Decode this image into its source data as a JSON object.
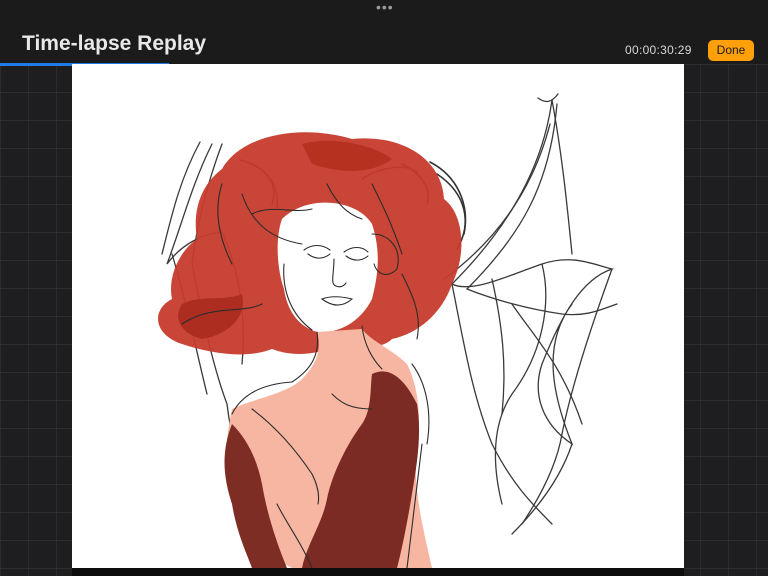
{
  "header": {
    "title": "Time-lapse Replay",
    "more_glyph": "•••",
    "timecode": "00:00:30:29",
    "done_label": "Done"
  },
  "playback": {
    "progress_fraction": 0.22
  },
  "colors": {
    "accent": "#ff9f0a",
    "progress": "#1e7ce8",
    "background": "#1c1c1e",
    "canvas": "#ffffff",
    "hair": "#c4382a",
    "skin": "#f6b19c",
    "dress": "#7a2a22"
  },
  "icons": {
    "more": "more-dots-icon"
  }
}
